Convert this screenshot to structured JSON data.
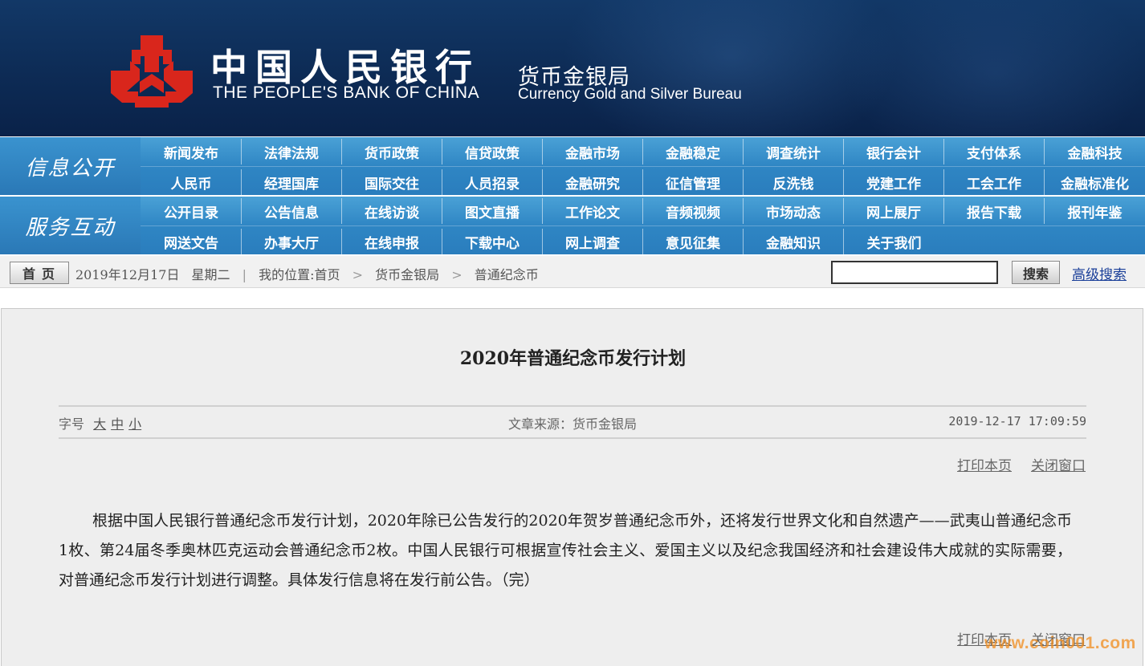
{
  "header": {
    "title_cn": "中国人民银行",
    "title_en": "THE PEOPLE'S BANK OF CHINA",
    "bureau_cn": "货币金银局",
    "bureau_en": "Currency  Gold and Silver Bureau",
    "logo_color": "#d9261c",
    "banner_color": "#0d2b55"
  },
  "nav": {
    "accent": "#2f86c4",
    "groups": [
      {
        "label": "信息公开",
        "rows": [
          [
            "新闻发布",
            "法律法规",
            "货币政策",
            "信贷政策",
            "金融市场",
            "金融稳定",
            "调查统计",
            "银行会计",
            "支付体系",
            "金融科技"
          ],
          [
            "人民币",
            "经理国库",
            "国际交往",
            "人员招录",
            "金融研究",
            "征信管理",
            "反洗钱",
            "党建工作",
            "工会工作",
            "金融标准化"
          ]
        ]
      },
      {
        "label": "服务互动",
        "rows": [
          [
            "公开目录",
            "公告信息",
            "在线访谈",
            "图文直播",
            "工作论文",
            "音频视频",
            "市场动态",
            "网上展厅",
            "报告下载",
            "报刊年鉴"
          ],
          [
            "网送文告",
            "办事大厅",
            "在线申报",
            "下载中心",
            "网上调查",
            "意见征集",
            "金融知识",
            "关于我们"
          ]
        ]
      }
    ]
  },
  "breadcrumb": {
    "home_label": "首页",
    "date": "2019年12月17日",
    "weekday": "星期二",
    "location_label": "我的位置:首页",
    "level1": "货币金银局",
    "level2": "普通纪念币",
    "separator": ">",
    "search_placeholder": "",
    "search_button": "搜索",
    "advanced_search": "高级搜索"
  },
  "article": {
    "title": "2020年普通纪念币发行计划",
    "font_size_label": "字号",
    "font_sizes": [
      "大",
      "中",
      "小"
    ],
    "source": "文章来源：货币金银局",
    "datetime": "2019-12-17 17:09:59",
    "print_label": "打印本页",
    "close_label": "关闭窗口",
    "body": "根据中国人民银行普通纪念币发行计划，2020年除已公告发行的2020年贺岁普通纪念币外，还将发行世界文化和自然遗产——武夷山普通纪念币1枚、第24届冬季奥林匹克运动会普通纪念币2枚。中国人民银行可根据宣传社会主义、爱国主义以及纪念我国经济和社会建设伟大成就的实际需要，对普通纪念币发行计划进行调整。具体发行信息将在发行前公告。（完）"
  },
  "watermark": "www.coin001.com"
}
